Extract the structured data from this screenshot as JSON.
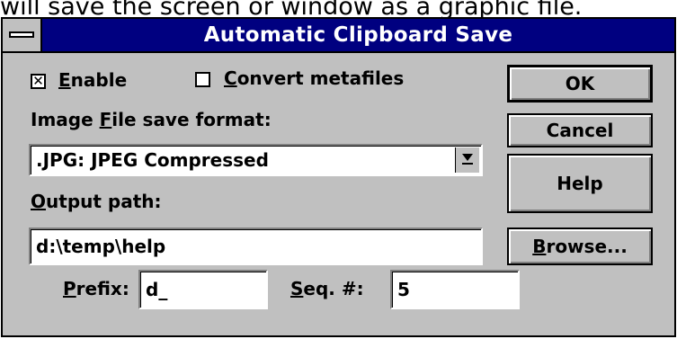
{
  "background_caption": "will save the screen or window as a graphic file.",
  "window": {
    "title": "Automatic Clipboard Save"
  },
  "enable_checkbox": {
    "checked": true,
    "mark": "✕",
    "mnemonic": "E",
    "rest": "nable"
  },
  "convert_checkbox": {
    "checked": false,
    "mark": "",
    "mnemonic": "C",
    "rest": "onvert metafiles"
  },
  "format": {
    "label_pre": "Image ",
    "label_mnemonic": "F",
    "label_post": "ile save format:",
    "value": ".JPG: JPEG Compressed"
  },
  "output": {
    "label_mnemonic": "O",
    "label_post": "utput path:",
    "value": "d:\\temp\\help"
  },
  "prefix": {
    "mnemonic": "P",
    "rest": "refix:",
    "value": "d_"
  },
  "seq": {
    "mnemonic": "S",
    "rest": "eq. #:",
    "value": "5"
  },
  "buttons": {
    "ok": "OK",
    "cancel": "Cancel",
    "help": "Help",
    "browse_mnemonic": "B",
    "browse_rest": "rowse..."
  },
  "icons": {
    "system_menu": "system-menu-icon",
    "dropdown": "chevron-down-icon"
  }
}
